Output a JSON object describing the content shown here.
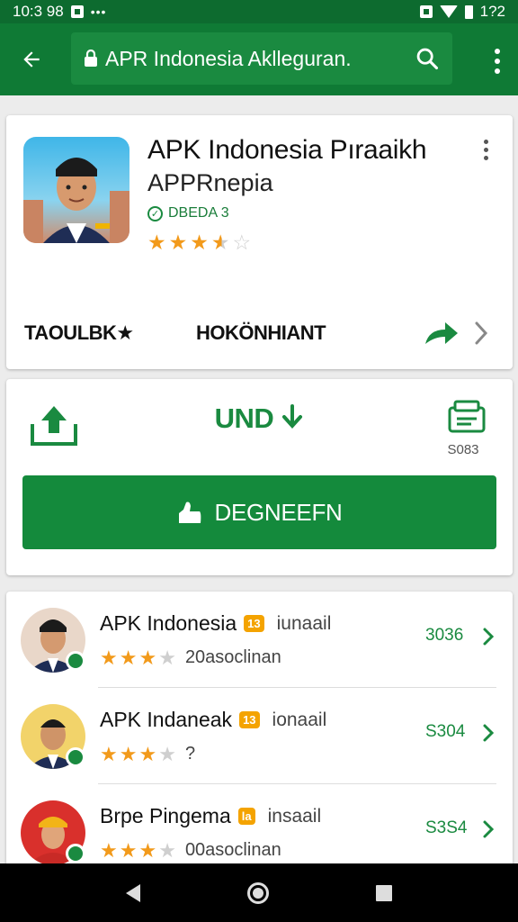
{
  "status_bar": {
    "time": "10:3 98",
    "right_text": "1?2"
  },
  "app_bar": {
    "url": "APR Indonesia Aklleguran."
  },
  "app_card": {
    "title": "APK Indonesia Pıraaikh",
    "developer": "APPRnepia",
    "verified_label": "DBEDA 3",
    "rating": 3.5,
    "foot_left": "TAOULBK★",
    "foot_mid": "HOKÖNHIANT"
  },
  "download_card": {
    "center_label": "UND",
    "right_size": "S083",
    "install_label": "DEGNEEFN"
  },
  "list": [
    {
      "title": "APK Indonesia",
      "badge": "13",
      "tag": "iunaail",
      "rating": 3,
      "reviews": "20asoclinan",
      "size": "3036"
    },
    {
      "title": "APK Indaneak",
      "badge": "13",
      "tag": "ionaail",
      "rating": 3,
      "reviews": "?",
      "size": "S304"
    },
    {
      "title": "Brpe Pingema",
      "badge": "la",
      "tag": "insaail",
      "rating": 3,
      "reviews": "00asoclinan",
      "size": "S3S4"
    }
  ],
  "colors": {
    "primary": "#0f7a35",
    "accent_green": "#1a8a40",
    "star": "#f29a1b"
  }
}
